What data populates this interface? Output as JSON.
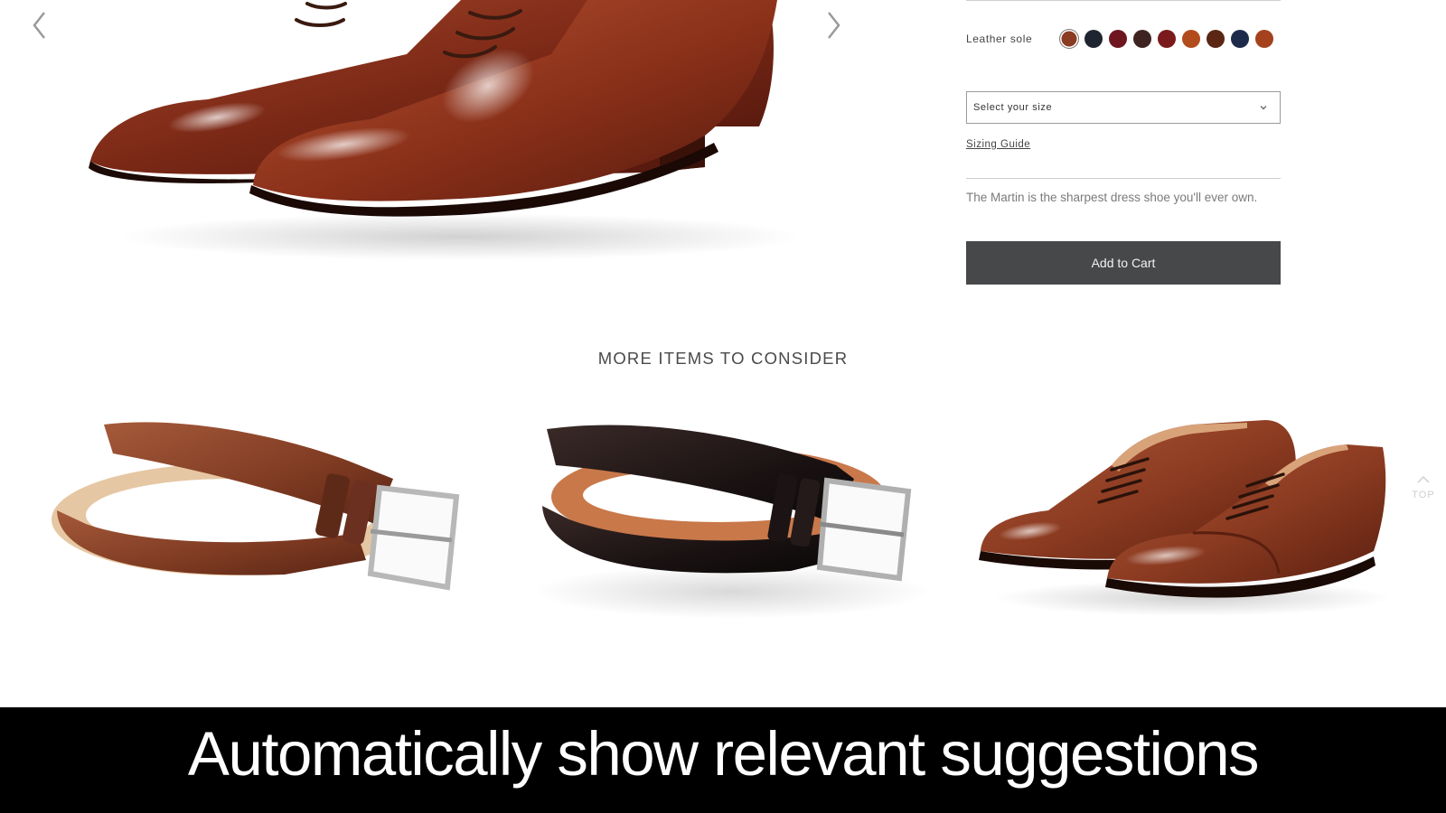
{
  "hero": {
    "image_icon": "oxford-shoe-pair",
    "prev_icon": "chevron-left-icon",
    "next_icon": "chevron-right-icon"
  },
  "product": {
    "sole_label": "Leather sole",
    "swatches": [
      {
        "color": "#8a3b22",
        "selected": true
      },
      {
        "color": "#1f2530",
        "selected": false
      },
      {
        "color": "#6e1520",
        "selected": false
      },
      {
        "color": "#3e2420",
        "selected": false
      },
      {
        "color": "#7a1a1c",
        "selected": false
      },
      {
        "color": "#b24c1c",
        "selected": false
      },
      {
        "color": "#5b2614",
        "selected": false
      },
      {
        "color": "#1e2a4a",
        "selected": false
      },
      {
        "color": "#a4421e",
        "selected": false
      }
    ],
    "size_placeholder": "Select your size",
    "sizing_guide": "Sizing Guide",
    "description": "The Martin is the sharpest dress shoe you'll ever own.",
    "add_to_cart": "Add to Cart"
  },
  "suggestions": {
    "title": "MORE ITEMS TO CONSIDER",
    "items": [
      {
        "image_icon": "brown-belt"
      },
      {
        "image_icon": "black-belt"
      },
      {
        "image_icon": "cap-toe-oxford-pair"
      }
    ]
  },
  "to_top": {
    "label": "TOP",
    "icon": "chevron-up-icon"
  },
  "caption": "Automatically show relevant suggestions",
  "colors": {
    "button_bg": "#474849",
    "caption_bg": "#000000",
    "leather_brown": "#7e2e19"
  }
}
